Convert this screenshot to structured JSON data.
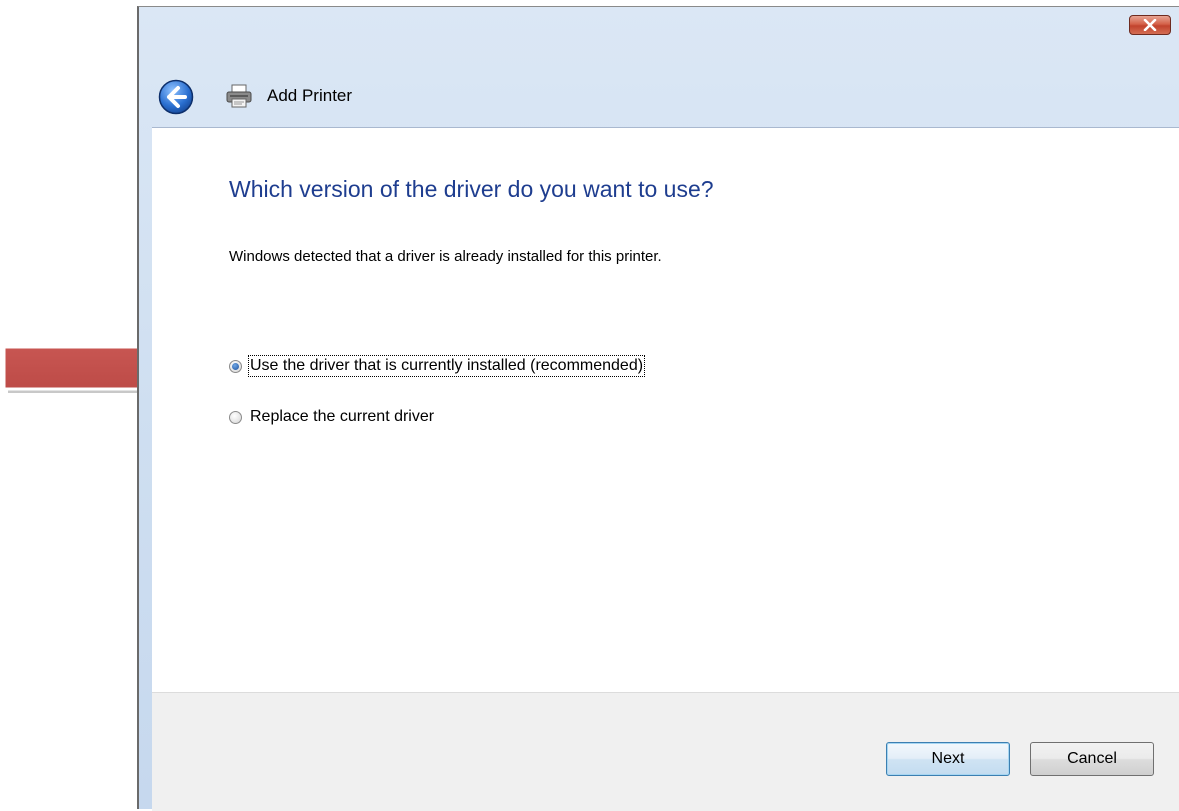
{
  "window": {
    "title": "Add Printer",
    "close_icon": "close-icon"
  },
  "content": {
    "heading": "Which version of the driver do you want to use?",
    "description": "Windows detected that a driver is already installed for this printer.",
    "options": [
      {
        "label": "Use the driver that is currently installed (recommended)",
        "checked": true,
        "accelerator": "U"
      },
      {
        "label": "Replace the current driver",
        "checked": false,
        "accelerator": "R"
      }
    ]
  },
  "footer": {
    "next_label": "Next",
    "cancel_label": "Cancel"
  },
  "annotation": {
    "arrow_color": "#c0504d"
  },
  "colors": {
    "heading": "#1e3d8f",
    "title_bar": "#cfdff1"
  }
}
